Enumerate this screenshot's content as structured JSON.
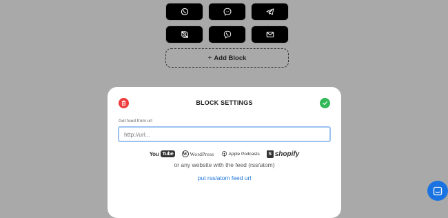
{
  "share_buttons": [
    {
      "name": "whatsapp-icon"
    },
    {
      "name": "messenger-icon"
    },
    {
      "name": "telegram-icon"
    },
    {
      "name": "skype-icon"
    },
    {
      "name": "viber-icon"
    },
    {
      "name": "email-icon"
    }
  ],
  "add_block": {
    "label": "Add Block",
    "icon": "plus-icon"
  },
  "panel": {
    "title": "BLOCK SETTINGS",
    "delete_icon": "trash-icon",
    "confirm_icon": "check-icon",
    "field_label": "Get feed from url",
    "input_placeholder": "http://url...",
    "input_value": "",
    "logos": {
      "youtube_a": "You",
      "youtube_b": "Tube",
      "wordpress_mark": "W",
      "wordpress": "WordPress",
      "apple_podcasts": "Apple Podcasts",
      "shopify_mark": "S",
      "shopify": "shopify"
    },
    "or_text": "or any website with the feed (rss/atom)",
    "link_text": "put rss/atom feed url"
  },
  "colors": {
    "background": "#a9a9a9",
    "delete": "#ee3b3b",
    "confirm": "#34b958",
    "link": "#1a73d9",
    "chat": "#1a73e0"
  },
  "chat_widget": {
    "icon": "chat-icon"
  }
}
